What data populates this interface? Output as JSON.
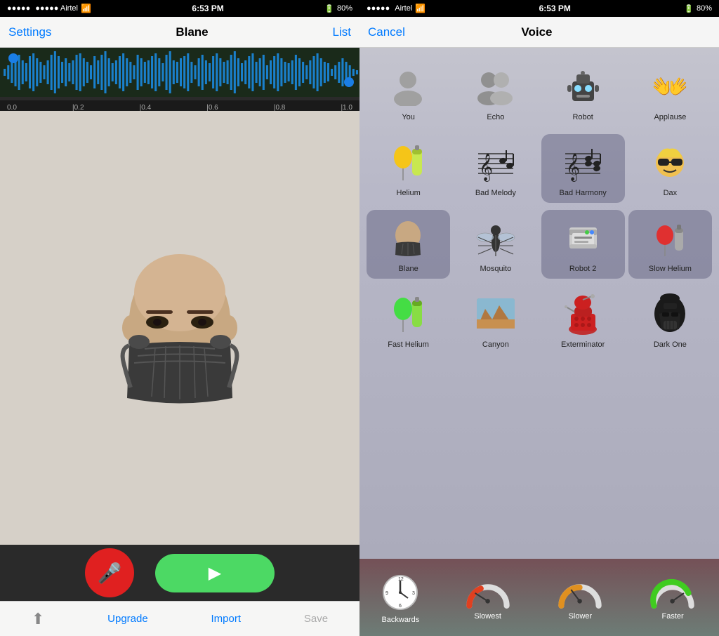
{
  "left": {
    "statusBar": {
      "carrier": "●●●●● Airtel",
      "wifi": "WiFi",
      "time": "6:53 PM",
      "battery": "80%"
    },
    "navBar": {
      "settings": "Settings",
      "title": "Blane",
      "list": "List"
    },
    "waveform": {
      "markers": [
        "0.0",
        "|0.2",
        "|0.4",
        "|0.6",
        "|0.8",
        "|1.0"
      ]
    },
    "bottomToolbar": {
      "upgrade": "Upgrade",
      "import": "Import",
      "save": "Save"
    }
  },
  "right": {
    "statusBar": {
      "carrier": "●●●●● Airtel",
      "wifi": "WiFi",
      "time": "6:53 PM",
      "battery": "80%"
    },
    "navBar": {
      "cancel": "Cancel",
      "title": "Voice"
    },
    "voices": [
      {
        "id": "you",
        "label": "You",
        "icon": "person"
      },
      {
        "id": "echo",
        "label": "Echo",
        "icon": "people"
      },
      {
        "id": "robot",
        "label": "Robot",
        "icon": "robot"
      },
      {
        "id": "applause",
        "label": "Applause",
        "icon": "hand"
      },
      {
        "id": "helium",
        "label": "Helium",
        "icon": "balloon"
      },
      {
        "id": "bad-melody",
        "label": "Bad Melody",
        "icon": "music"
      },
      {
        "id": "bad-harmony",
        "label": "Bad Harmony",
        "icon": "music2",
        "selected": true
      },
      {
        "id": "dax",
        "label": "Dax",
        "icon": "sunglasses"
      },
      {
        "id": "blane",
        "label": "Blane",
        "icon": "bane",
        "selected": true
      },
      {
        "id": "mosquito",
        "label": "Mosquito",
        "icon": "mosquito"
      },
      {
        "id": "robot2",
        "label": "Robot 2",
        "icon": "robot2",
        "selected": true
      },
      {
        "id": "slow-helium",
        "label": "Slow Helium",
        "icon": "slow-helium",
        "selected": true
      },
      {
        "id": "fast-helium",
        "label": "Fast Helium",
        "icon": "fast-balloon"
      },
      {
        "id": "canyon",
        "label": "Canyon",
        "icon": "canyon"
      },
      {
        "id": "exterminator",
        "label": "Exterminator",
        "icon": "dalek"
      },
      {
        "id": "dark-one",
        "label": "Dark One",
        "icon": "darth"
      }
    ],
    "speeds": [
      {
        "id": "backwards",
        "label": "Backwards",
        "icon": "clock"
      },
      {
        "id": "slowest",
        "label": "Slowest",
        "icon": "gauge-red"
      },
      {
        "id": "slower",
        "label": "Slower",
        "icon": "gauge-orange"
      },
      {
        "id": "faster",
        "label": "Faster",
        "icon": "gauge-green"
      }
    ]
  }
}
